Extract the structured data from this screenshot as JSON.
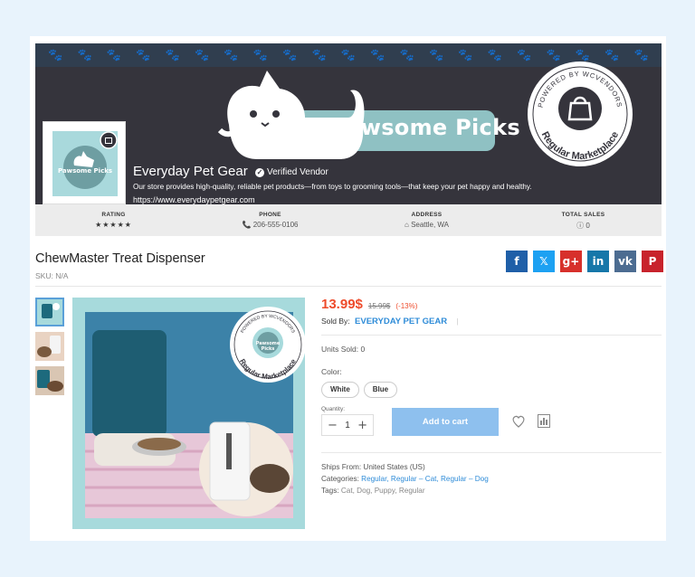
{
  "store": {
    "brand": "Pawsome Picks",
    "badge_top": "POWERED BY WCVENDORS",
    "badge_bottom": "Regular Marketplace",
    "vendor_name": "Everyday Pet Gear",
    "verified": "Verified Vendor",
    "description": "Our store provides high-quality, reliable pet products—from toys to grooming tools—that keep your pet happy and healthy.",
    "url": "https://www.everydaypetgear.com",
    "logo_text": "Pawsome Picks"
  },
  "stats": {
    "rating_label": "RATING",
    "rating_stars": "★★★★★",
    "phone_label": "PHONE",
    "phone": "206-555-0106",
    "address_label": "ADDRESS",
    "address": "Seattle, WA",
    "sales_label": "TOTAL SALES",
    "sales": "0"
  },
  "product": {
    "title": "ChewMaster Treat Dispenser",
    "sku": "SKU: N/A",
    "price": "13.99$",
    "old_price": "15.99$",
    "discount": "(-13%)",
    "sold_by_label": "Sold By:",
    "sold_by": "EVERYDAY PET GEAR",
    "units_sold": "Units Sold: 0",
    "color_label": "Color:",
    "colors": [
      "White",
      "Blue"
    ],
    "quantity_label": "Quantity:",
    "quantity": "1",
    "add_to_cart": "Add to cart",
    "ships_from_label": "Ships From:",
    "ships_from": "United States (US)",
    "categories_label": "Categories:",
    "categories": "Regular, Regular – Cat, Regular – Dog",
    "tags_label": "Tags:",
    "tags": "Cat, Dog, Puppy, Regular"
  },
  "share": [
    {
      "icon": "facebook-icon",
      "glyph": "f",
      "color": "#1f5fa8"
    },
    {
      "icon": "x-icon",
      "glyph": "𝕏",
      "color": "#1da1f2"
    },
    {
      "icon": "google-plus-icon",
      "glyph": "g+",
      "color": "#d7302b"
    },
    {
      "icon": "linkedin-icon",
      "glyph": "in",
      "color": "#1677a9"
    },
    {
      "icon": "vk-icon",
      "glyph": "vk",
      "color": "#4c6c91"
    },
    {
      "icon": "pinterest-icon",
      "glyph": "P",
      "color": "#c8232c"
    }
  ],
  "colors": {
    "price": "#ee4b2b",
    "link": "#2f8cd8",
    "banner": "#35343c",
    "cart": "#8ec0ee"
  }
}
